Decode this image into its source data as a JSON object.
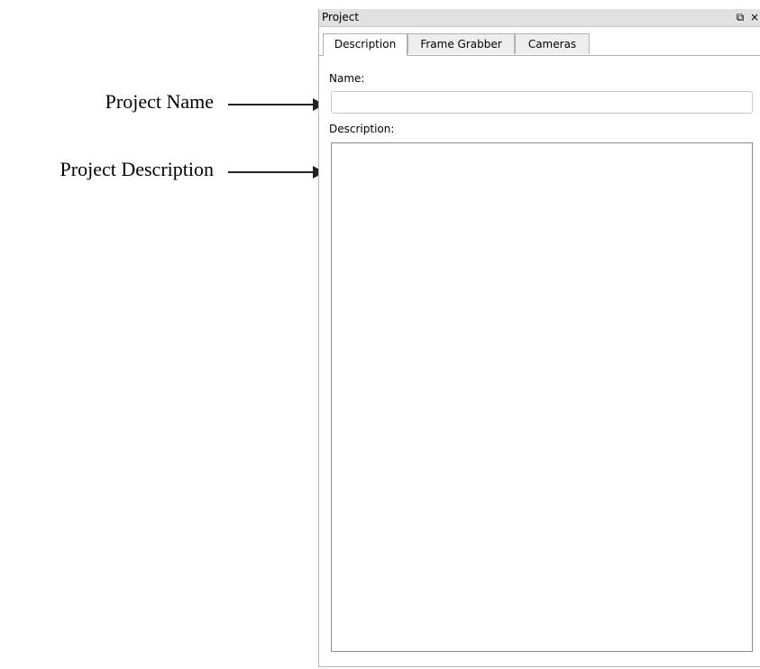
{
  "annotations": {
    "project_name": "Project Name",
    "project_description": "Project Description"
  },
  "panel": {
    "title": "Project",
    "float_icon": "⧉",
    "close_icon": "×"
  },
  "tabs": [
    {
      "label": "Description",
      "active": true
    },
    {
      "label": "Frame Grabber",
      "active": false
    },
    {
      "label": "Cameras",
      "active": false
    }
  ],
  "form": {
    "name_label": "Name:",
    "name_value": "",
    "description_label": "Description:",
    "description_value": ""
  }
}
